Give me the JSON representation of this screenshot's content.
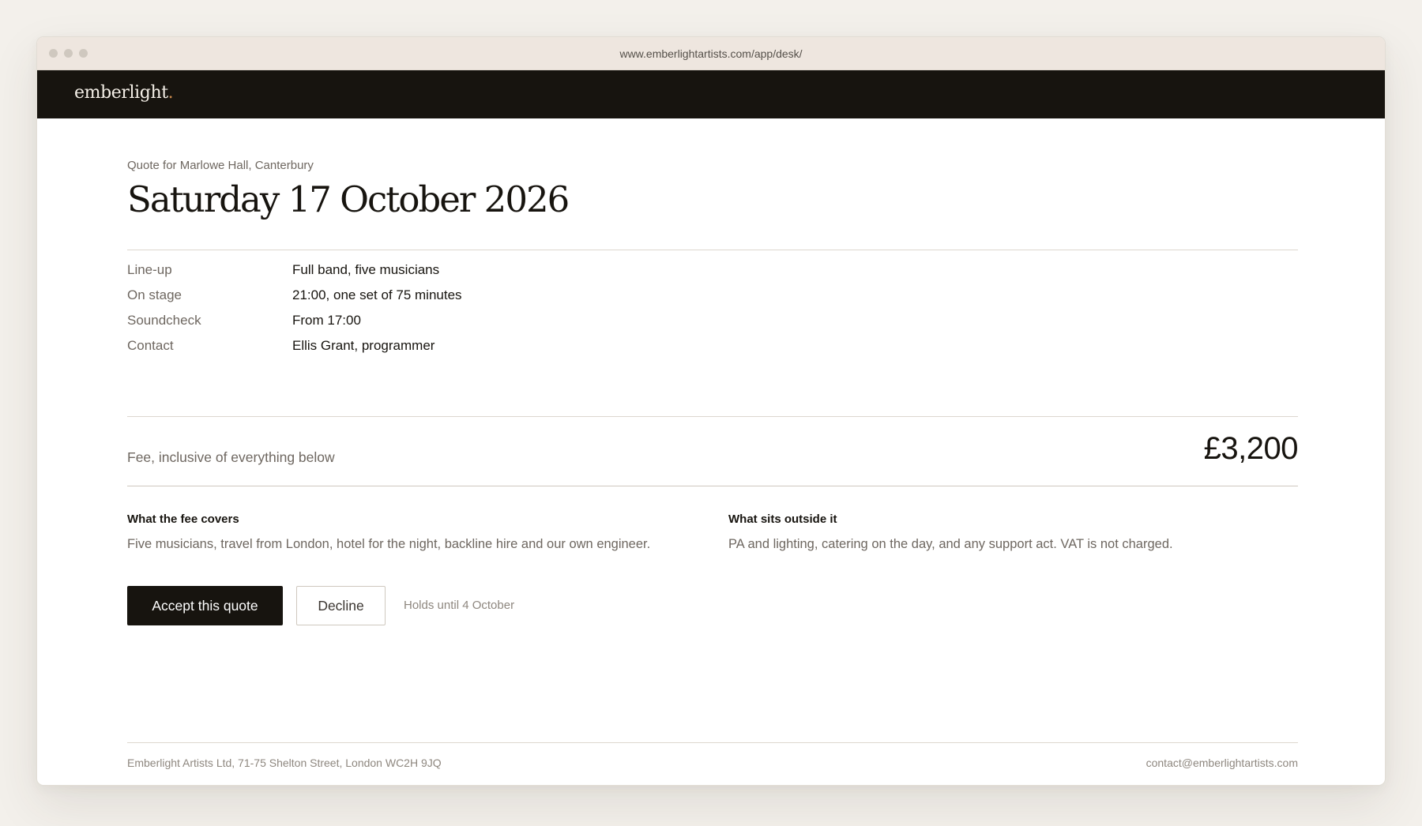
{
  "browser": {
    "url": "www.emberlightartists.com/app/desk/"
  },
  "brand": {
    "name": "emberlight",
    "dot": "."
  },
  "quote": {
    "eyebrow": "Quote for Marlowe Hall, Canterbury",
    "date": "Saturday 17 October 2026",
    "details": [
      {
        "label": "Line-up",
        "value": "Full band, five musicians"
      },
      {
        "label": "On stage",
        "value": "21:00, one set of 75 minutes"
      },
      {
        "label": "Soundcheck",
        "value": "From 17:00"
      },
      {
        "label": "Contact",
        "value": "Ellis Grant, programmer"
      }
    ],
    "fee_label": "Fee, inclusive of everything below",
    "fee_amount": "£3,200",
    "covers": {
      "title": "What the fee covers",
      "text": "Five musicians, travel from London, hotel for the night, backline hire and our own engineer."
    },
    "outside": {
      "title": "What sits outside it",
      "text": "PA and lighting, catering on the day, and any support act. VAT is not charged."
    },
    "actions": {
      "accept_label": "Accept this quote",
      "decline_label": "Decline",
      "hold_note": "Holds until 4 October"
    }
  },
  "footer": {
    "address": "Emberlight Artists Ltd, 71-75 Shelton Street, London WC2H 9JQ",
    "email": "contact@emberlightartists.com"
  },
  "colors": {
    "page_background": "#f3f0eb",
    "titlebar": "#eee6df",
    "topbar": "#17140f",
    "brand_accent": "#c9874a",
    "primary_button": "#17140f",
    "muted_text": "#6e6760"
  }
}
